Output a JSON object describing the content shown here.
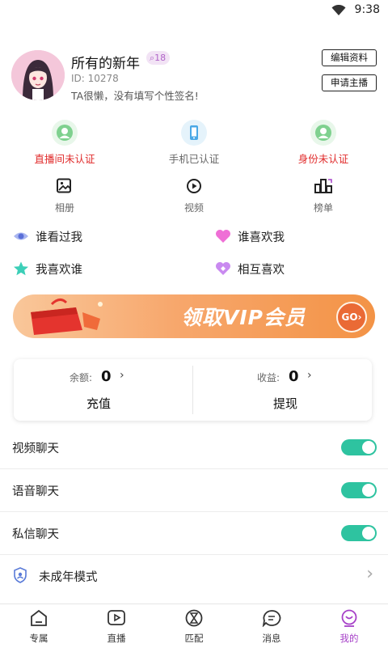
{
  "status": {
    "time": "9:38"
  },
  "profile": {
    "nickname": "所有的新年",
    "level": "18",
    "id_text": "ID: 10278",
    "signature": "TA很懒，没有填写个性签名!",
    "edit_label": "编辑资料",
    "apply_label": "申请主播"
  },
  "certs": [
    {
      "label": "直播间未认证",
      "color": "#e02a2a"
    },
    {
      "label": "手机已认证",
      "color": "#666666"
    },
    {
      "label": "身份未认证",
      "color": "#e02a2a"
    }
  ],
  "functions": [
    {
      "label": "相册",
      "icon": "photo-album-icon"
    },
    {
      "label": "视频",
      "icon": "video-play-icon"
    },
    {
      "label": "榜单",
      "icon": "ranking-icon"
    }
  ],
  "likes": [
    {
      "label": "谁看过我",
      "icon": "eye-icon"
    },
    {
      "label": "谁喜欢我",
      "icon": "heart-icon"
    },
    {
      "label": "我喜欢谁",
      "icon": "star-icon"
    },
    {
      "label": "相互喜欢",
      "icon": "mutual-heart-icon"
    }
  ],
  "banner": {
    "text": "领取VIP会员",
    "go": "GO"
  },
  "wallet": {
    "balance_label": "余额:",
    "balance_value": "0",
    "recharge_label": "充值",
    "income_label": "收益:",
    "income_value": "0",
    "withdraw_label": "提现"
  },
  "settings": [
    {
      "label": "视频聊天",
      "enabled": true
    },
    {
      "label": "语音聊天",
      "enabled": true
    },
    {
      "label": "私信聊天",
      "enabled": true
    }
  ],
  "minor_mode": {
    "label": "未成年模式"
  },
  "nav": [
    {
      "label": "专属",
      "icon": "home-icon"
    },
    {
      "label": "直播",
      "icon": "live-icon"
    },
    {
      "label": "匹配",
      "icon": "match-icon"
    },
    {
      "label": "消息",
      "icon": "message-icon"
    },
    {
      "label": "我的",
      "icon": "profile-icon",
      "active": true
    }
  ],
  "colors": {
    "accent": "#2ec3a0",
    "active_nav": "#a640c8",
    "warn": "#e02a2a"
  }
}
